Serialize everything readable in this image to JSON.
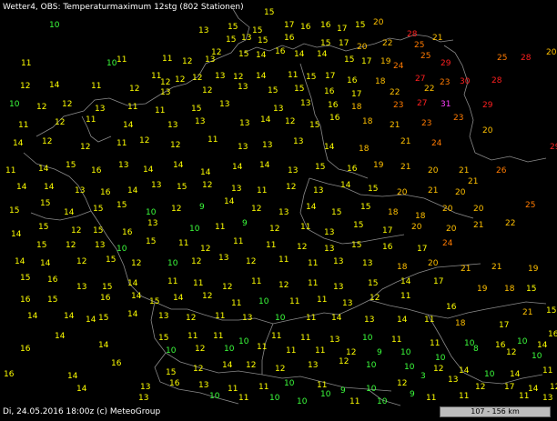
{
  "header": {
    "title": "Wetter4, OBS: Temperaturmaximum 12stg (802 Stationen)"
  },
  "footer": {
    "text": "Di, 24.05.2016 18:00z (c) MeteoGroup"
  },
  "scale": {
    "label": "107 - 156 km"
  },
  "colors": {
    "background": "#000000",
    "borders": "#8a8a8a",
    "text": "#ffffff",
    "t_le10": "#3cff3c",
    "t_11_17": "#ffff00",
    "t_18_22": "#ffc000",
    "t_23_26": "#ff7a00",
    "t_27_plus": "#ff2020",
    "t_31_plus": "#ff40ff"
  },
  "stations": [
    [
      54,
      30,
      10
    ],
    [
      218,
      36,
      13
    ],
    [
      250,
      32,
      15
    ],
    [
      277,
      36,
      15
    ],
    [
      290,
      16,
      15
    ],
    [
      312,
      30,
      17
    ],
    [
      330,
      32,
      16
    ],
    [
      352,
      30,
      16
    ],
    [
      370,
      34,
      17
    ],
    [
      390,
      30,
      15
    ],
    [
      410,
      27,
      20
    ],
    [
      447,
      40,
      28
    ],
    [
      23,
      72,
      11
    ],
    [
      117,
      72,
      10
    ],
    [
      128,
      68,
      11
    ],
    [
      178,
      67,
      11
    ],
    [
      200,
      70,
      12
    ],
    [
      225,
      68,
      13
    ],
    [
      248,
      46,
      15
    ],
    [
      265,
      44,
      13
    ],
    [
      283,
      47,
      15
    ],
    [
      312,
      44,
      16
    ],
    [
      352,
      50,
      15
    ],
    [
      372,
      50,
      17
    ],
    [
      392,
      54,
      20
    ],
    [
      420,
      50,
      22
    ],
    [
      455,
      52,
      25
    ],
    [
      475,
      44,
      21
    ],
    [
      232,
      60,
      12
    ],
    [
      262,
      62,
      15
    ],
    [
      281,
      63,
      14
    ],
    [
      302,
      59,
      16
    ],
    [
      323,
      62,
      14
    ],
    [
      348,
      62,
      14
    ],
    [
      378,
      68,
      15
    ],
    [
      397,
      70,
      17
    ],
    [
      418,
      70,
      19
    ],
    [
      432,
      75,
      24
    ],
    [
      462,
      64,
      25
    ],
    [
      484,
      72,
      29
    ],
    [
      546,
      66,
      25
    ],
    [
      572,
      66,
      28
    ],
    [
      600,
      60,
      20
    ],
    [
      166,
      86,
      11
    ],
    [
      176,
      93,
      12
    ],
    [
      192,
      90,
      12
    ],
    [
      211,
      88,
      12
    ],
    [
      236,
      86,
      13
    ],
    [
      256,
      87,
      12
    ],
    [
      281,
      86,
      14
    ],
    [
      316,
      85,
      11
    ],
    [
      336,
      87,
      15
    ],
    [
      357,
      86,
      17
    ],
    [
      381,
      91,
      16
    ],
    [
      412,
      92,
      18
    ],
    [
      456,
      89,
      27
    ],
    [
      483,
      93,
      23
    ],
    [
      540,
      91,
      28
    ],
    [
      22,
      97,
      12
    ],
    [
      54,
      96,
      14
    ],
    [
      100,
      97,
      11
    ],
    [
      142,
      100,
      12
    ],
    [
      176,
      104,
      13
    ],
    [
      222,
      102,
      12
    ],
    [
      261,
      98,
      13
    ],
    [
      294,
      102,
      15
    ],
    [
      323,
      100,
      15
    ],
    [
      356,
      103,
      16
    ],
    [
      386,
      106,
      17
    ],
    [
      428,
      104,
      22
    ],
    [
      466,
      100,
      22
    ],
    [
      505,
      92,
      30
    ],
    [
      10,
      117,
      10
    ],
    [
      40,
      120,
      12
    ],
    [
      68,
      117,
      12
    ],
    [
      104,
      122,
      13
    ],
    [
      140,
      120,
      11
    ],
    [
      170,
      124,
      11
    ],
    [
      210,
      122,
      15
    ],
    [
      241,
      117,
      13
    ],
    [
      300,
      122,
      13
    ],
    [
      330,
      116,
      13
    ],
    [
      360,
      118,
      16
    ],
    [
      386,
      120,
      18
    ],
    [
      432,
      118,
      23
    ],
    [
      458,
      116,
      27
    ],
    [
      484,
      117,
      31
    ],
    [
      530,
      118,
      29
    ],
    [
      20,
      140,
      11
    ],
    [
      60,
      137,
      12
    ],
    [
      94,
      134,
      11
    ],
    [
      135,
      140,
      14
    ],
    [
      184,
      140,
      13
    ],
    [
      214,
      136,
      13
    ],
    [
      263,
      138,
      13
    ],
    [
      286,
      134,
      14
    ],
    [
      313,
      136,
      12
    ],
    [
      340,
      140,
      15
    ],
    [
      362,
      132,
      16
    ],
    [
      398,
      136,
      18
    ],
    [
      428,
      140,
      21
    ],
    [
      463,
      138,
      23
    ],
    [
      498,
      132,
      23
    ],
    [
      14,
      160,
      14
    ],
    [
      46,
      158,
      12
    ],
    [
      88,
      164,
      12
    ],
    [
      128,
      160,
      11
    ],
    [
      153,
      157,
      12
    ],
    [
      187,
      162,
      12
    ],
    [
      228,
      156,
      11
    ],
    [
      261,
      164,
      13
    ],
    [
      288,
      162,
      13
    ],
    [
      322,
      158,
      13
    ],
    [
      356,
      164,
      14
    ],
    [
      394,
      166,
      18
    ],
    [
      440,
      158,
      21
    ],
    [
      474,
      160,
      24
    ],
    [
      530,
      146,
      20
    ],
    [
      604,
      164,
      29
    ],
    [
      6,
      190,
      11
    ],
    [
      42,
      188,
      14
    ],
    [
      72,
      184,
      15
    ],
    [
      100,
      190,
      16
    ],
    [
      130,
      184,
      13
    ],
    [
      157,
      189,
      14
    ],
    [
      190,
      184,
      14
    ],
    [
      220,
      192,
      14
    ],
    [
      255,
      186,
      14
    ],
    [
      285,
      184,
      14
    ],
    [
      316,
      190,
      13
    ],
    [
      346,
      186,
      15
    ],
    [
      381,
      188,
      16
    ],
    [
      410,
      184,
      19
    ],
    [
      440,
      186,
      21
    ],
    [
      470,
      190,
      20
    ],
    [
      504,
      190,
      21
    ],
    [
      545,
      190,
      26
    ],
    [
      18,
      208,
      14
    ],
    [
      48,
      208,
      14
    ],
    [
      82,
      212,
      13
    ],
    [
      110,
      214,
      16
    ],
    [
      140,
      212,
      14
    ],
    [
      166,
      206,
      13
    ],
    [
      194,
      208,
      15
    ],
    [
      222,
      206,
      12
    ],
    [
      254,
      210,
      13
    ],
    [
      282,
      212,
      11
    ],
    [
      314,
      208,
      12
    ],
    [
      344,
      212,
      13
    ],
    [
      374,
      206,
      14
    ],
    [
      404,
      210,
      15
    ],
    [
      436,
      214,
      20
    ],
    [
      470,
      212,
      21
    ],
    [
      500,
      214,
      20
    ],
    [
      514,
      202,
      21
    ],
    [
      10,
      234,
      15
    ],
    [
      44,
      226,
      15
    ],
    [
      70,
      236,
      14
    ],
    [
      102,
      232,
      15
    ],
    [
      128,
      228,
      15
    ],
    [
      160,
      236,
      10
    ],
    [
      188,
      232,
      12
    ],
    [
      219,
      230,
      9
    ],
    [
      246,
      224,
      14
    ],
    [
      276,
      232,
      12
    ],
    [
      306,
      236,
      13
    ],
    [
      336,
      230,
      14
    ],
    [
      364,
      236,
      15
    ],
    [
      396,
      230,
      15
    ],
    [
      426,
      236,
      18
    ],
    [
      456,
      240,
      18
    ],
    [
      486,
      232,
      20
    ],
    [
      520,
      232,
      20
    ],
    [
      577,
      228,
      25
    ],
    [
      12,
      260,
      14
    ],
    [
      42,
      252,
      15
    ],
    [
      78,
      256,
      12
    ],
    [
      102,
      256,
      15
    ],
    [
      134,
      258,
      16
    ],
    [
      162,
      248,
      13
    ],
    [
      208,
      254,
      10
    ],
    [
      236,
      252,
      11
    ],
    [
      266,
      248,
      9
    ],
    [
      296,
      254,
      12
    ],
    [
      330,
      252,
      11
    ],
    [
      356,
      258,
      13
    ],
    [
      388,
      250,
      15
    ],
    [
      420,
      256,
      17
    ],
    [
      452,
      252,
      20
    ],
    [
      490,
      254,
      20
    ],
    [
      520,
      250,
      21
    ],
    [
      555,
      248,
      22
    ],
    [
      40,
      272,
      15
    ],
    [
      72,
      272,
      12
    ],
    [
      104,
      272,
      13
    ],
    [
      128,
      276,
      10
    ],
    [
      160,
      268,
      15
    ],
    [
      196,
      270,
      11
    ],
    [
      220,
      276,
      12
    ],
    [
      256,
      268,
      11
    ],
    [
      292,
      272,
      11
    ],
    [
      326,
      274,
      12
    ],
    [
      356,
      276,
      13
    ],
    [
      386,
      272,
      15
    ],
    [
      420,
      274,
      16
    ],
    [
      458,
      276,
      17
    ],
    [
      486,
      270,
      24
    ],
    [
      16,
      290,
      14
    ],
    [
      44,
      292,
      14
    ],
    [
      84,
      290,
      12
    ],
    [
      116,
      288,
      15
    ],
    [
      144,
      292,
      12
    ],
    [
      184,
      292,
      10
    ],
    [
      210,
      290,
      12
    ],
    [
      240,
      286,
      13
    ],
    [
      270,
      290,
      12
    ],
    [
      306,
      288,
      11
    ],
    [
      338,
      292,
      11
    ],
    [
      366,
      290,
      13
    ],
    [
      398,
      292,
      13
    ],
    [
      436,
      296,
      18
    ],
    [
      470,
      292,
      20
    ],
    [
      22,
      308,
      15
    ],
    [
      52,
      310,
      16
    ],
    [
      84,
      318,
      13
    ],
    [
      112,
      318,
      15
    ],
    [
      140,
      314,
      14
    ],
    [
      184,
      312,
      11
    ],
    [
      212,
      314,
      11
    ],
    [
      244,
      318,
      12
    ],
    [
      276,
      312,
      11
    ],
    [
      306,
      316,
      12
    ],
    [
      338,
      314,
      11
    ],
    [
      366,
      318,
      13
    ],
    [
      404,
      314,
      15
    ],
    [
      440,
      312,
      14
    ],
    [
      476,
      312,
      17
    ],
    [
      506,
      298,
      21
    ],
    [
      540,
      296,
      21
    ],
    [
      580,
      298,
      19
    ],
    [
      22,
      332,
      16
    ],
    [
      52,
      332,
      15
    ],
    [
      110,
      330,
      16
    ],
    [
      144,
      328,
      14
    ],
    [
      164,
      334,
      15
    ],
    [
      190,
      330,
      14
    ],
    [
      222,
      328,
      12
    ],
    [
      254,
      336,
      11
    ],
    [
      284,
      334,
      10
    ],
    [
      318,
      334,
      11
    ],
    [
      348,
      332,
      11
    ],
    [
      376,
      336,
      13
    ],
    [
      406,
      330,
      12
    ],
    [
      440,
      328,
      11
    ],
    [
      490,
      340,
      16
    ],
    [
      524,
      320,
      19
    ],
    [
      554,
      320,
      18
    ],
    [
      578,
      320,
      15
    ],
    [
      30,
      350,
      14
    ],
    [
      70,
      350,
      14
    ],
    [
      108,
      352,
      15
    ],
    [
      140,
      348,
      14
    ],
    [
      174,
      350,
      13
    ],
    [
      204,
      352,
      12
    ],
    [
      236,
      350,
      11
    ],
    [
      266,
      352,
      13
    ],
    [
      302,
      352,
      10
    ],
    [
      336,
      352,
      11
    ],
    [
      364,
      352,
      14
    ],
    [
      400,
      354,
      13
    ],
    [
      436,
      354,
      14
    ],
    [
      466,
      354,
      11
    ],
    [
      500,
      358,
      18
    ],
    [
      548,
      360,
      17
    ],
    [
      574,
      346,
      21
    ],
    [
      600,
      344,
      15
    ],
    [
      60,
      372,
      14
    ],
    [
      94,
      354,
      14
    ],
    [
      174,
      374,
      15
    ],
    [
      206,
      372,
      11
    ],
    [
      234,
      372,
      11
    ],
    [
      262,
      378,
      10
    ],
    [
      298,
      372,
      11
    ],
    [
      330,
      374,
      11
    ],
    [
      362,
      376,
      13
    ],
    [
      398,
      374,
      10
    ],
    [
      430,
      376,
      11
    ],
    [
      472,
      380,
      11
    ],
    [
      510,
      380,
      10
    ],
    [
      544,
      382,
      16
    ],
    [
      568,
      378,
      10
    ],
    [
      590,
      382,
      14
    ],
    [
      602,
      370,
      16
    ],
    [
      22,
      386,
      16
    ],
    [
      108,
      382,
      14
    ],
    [
      182,
      388,
      10
    ],
    [
      214,
      386,
      12
    ],
    [
      246,
      386,
      10
    ],
    [
      282,
      384,
      11
    ],
    [
      314,
      388,
      11
    ],
    [
      346,
      388,
      11
    ],
    [
      380,
      390,
      12
    ],
    [
      414,
      390,
      9
    ],
    [
      440,
      390,
      10
    ],
    [
      478,
      396,
      10
    ],
    [
      520,
      386,
      8
    ],
    [
      556,
      390,
      12
    ],
    [
      584,
      394,
      10
    ],
    [
      4,
      414,
      16
    ],
    [
      74,
      416,
      14
    ],
    [
      122,
      402,
      16
    ],
    [
      182,
      412,
      15
    ],
    [
      212,
      408,
      12
    ],
    [
      244,
      404,
      14
    ],
    [
      270,
      404,
      12
    ],
    [
      302,
      408,
      12
    ],
    [
      338,
      404,
      13
    ],
    [
      372,
      400,
      12
    ],
    [
      402,
      404,
      10
    ],
    [
      444,
      406,
      10
    ],
    [
      476,
      408,
      12
    ],
    [
      504,
      410,
      14
    ],
    [
      532,
      414,
      10
    ],
    [
      560,
      414,
      14
    ],
    [
      596,
      410,
      11
    ],
    [
      84,
      430,
      14
    ],
    [
      154,
      428,
      13
    ],
    [
      186,
      424,
      16
    ],
    [
      218,
      426,
      13
    ],
    [
      250,
      430,
      11
    ],
    [
      284,
      428,
      11
    ],
    [
      312,
      424,
      10
    ],
    [
      348,
      426,
      11
    ],
    [
      374,
      432,
      9
    ],
    [
      402,
      430,
      10
    ],
    [
      436,
      424,
      12
    ],
    [
      462,
      416,
      3
    ],
    [
      492,
      420,
      13
    ],
    [
      522,
      428,
      12
    ],
    [
      554,
      428,
      17
    ],
    [
      580,
      430,
      14
    ],
    [
      604,
      428,
      12
    ],
    [
      152,
      440,
      13
    ],
    [
      230,
      438,
      10
    ],
    [
      262,
      440,
      11
    ],
    [
      296,
      440,
      10
    ],
    [
      326,
      444,
      10
    ],
    [
      352,
      436,
      10
    ],
    [
      384,
      444,
      11
    ],
    [
      414,
      444,
      10
    ],
    [
      450,
      436,
      9
    ],
    [
      468,
      440,
      11
    ],
    [
      504,
      438,
      11
    ],
    [
      570,
      438,
      11
    ],
    [
      596,
      440,
      13
    ]
  ]
}
